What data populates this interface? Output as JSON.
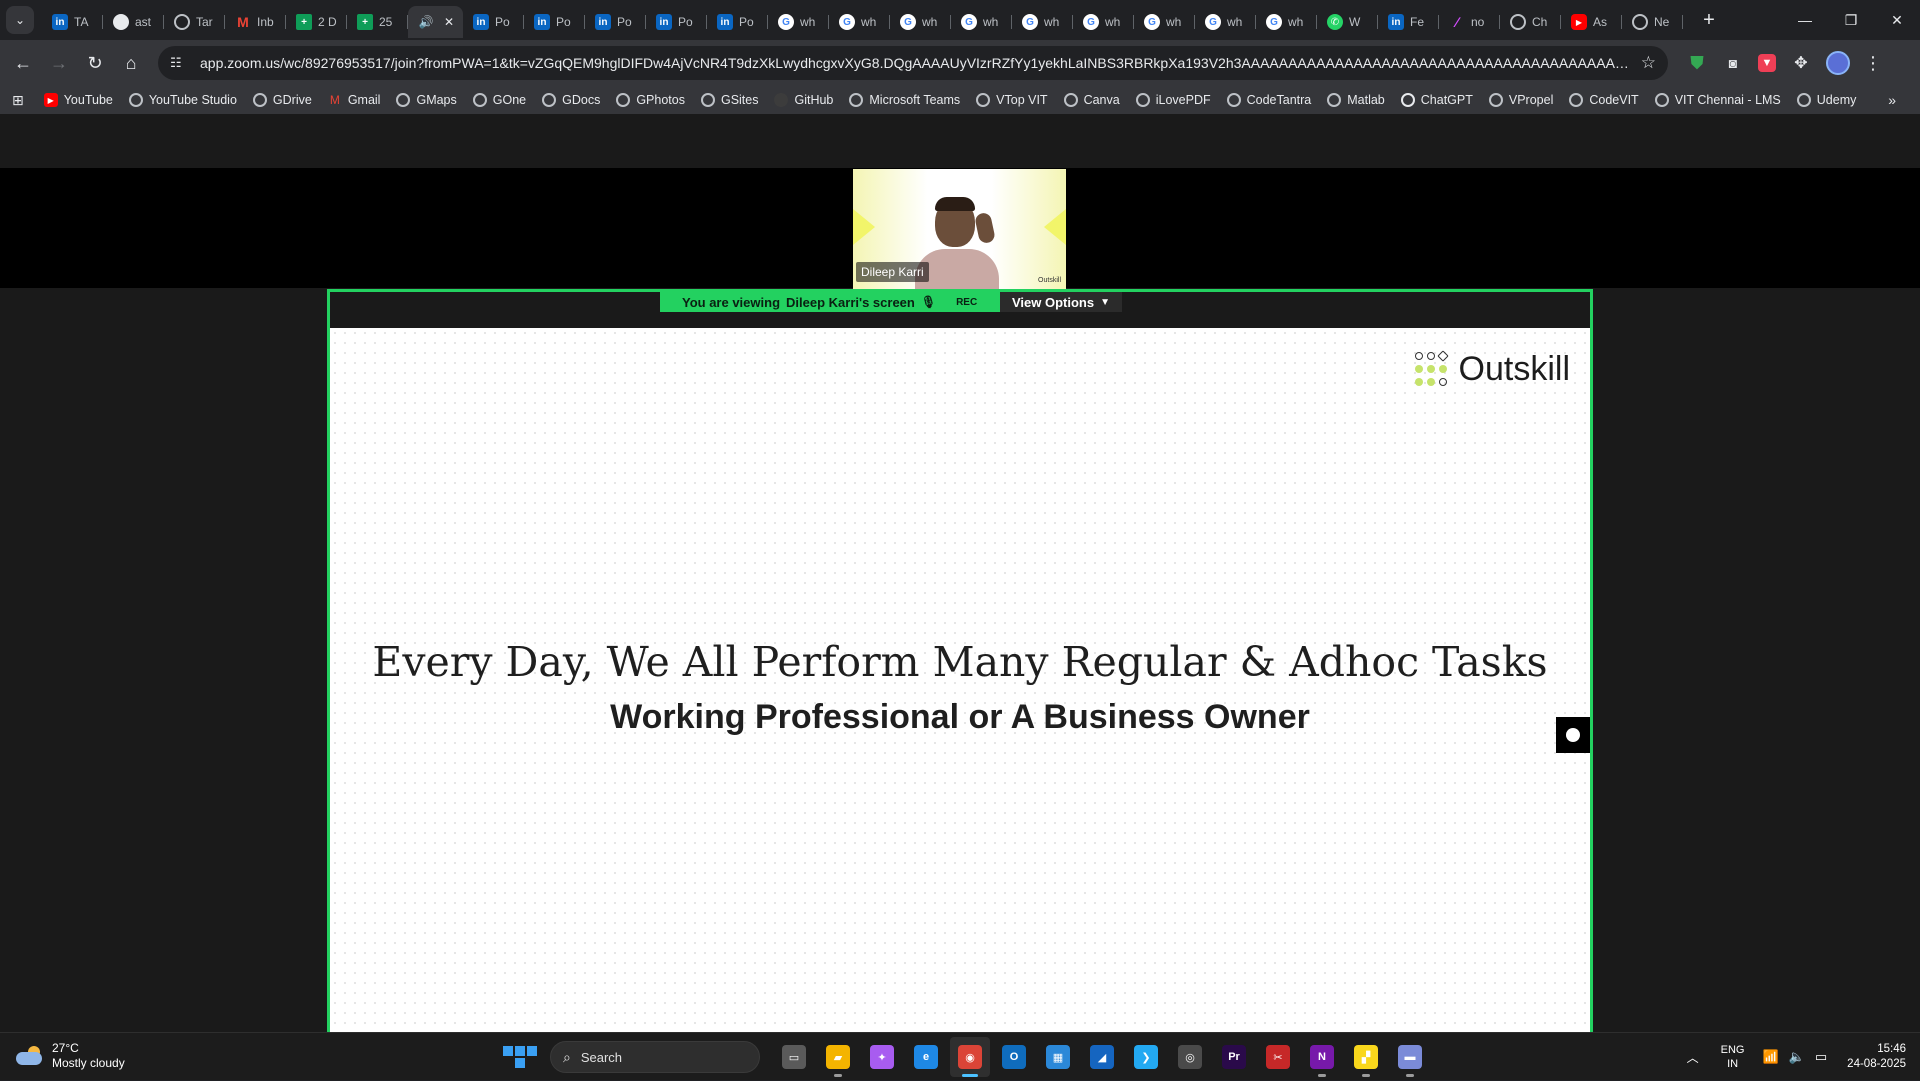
{
  "browser": {
    "tabs": [
      {
        "label": "TA",
        "icon": "linkedin-icon",
        "glyph": "in",
        "cls": "fav-linkedin"
      },
      {
        "label": "ast",
        "icon": "github-icon",
        "glyph": "",
        "cls": "fav-github"
      },
      {
        "label": "Tar",
        "icon": "globe-icon",
        "glyph": "",
        "cls": "fav-globe"
      },
      {
        "label": "Inb",
        "icon": "gmail-icon",
        "glyph": "M",
        "cls": "fav-gmail"
      },
      {
        "label": "2 D",
        "icon": "sheets-icon",
        "glyph": "+",
        "cls": "fav-sheets"
      },
      {
        "label": "25",
        "icon": "sheets-icon",
        "glyph": "+",
        "cls": "fav-sheets"
      },
      {
        "label": "",
        "icon": "speaker-icon",
        "glyph": "🔊",
        "cls": "fav-speaker",
        "active": true
      },
      {
        "label": "Po",
        "icon": "linkedin-icon",
        "glyph": "in",
        "cls": "fav-linkedin"
      },
      {
        "label": "Po",
        "icon": "linkedin-icon",
        "glyph": "in",
        "cls": "fav-linkedin"
      },
      {
        "label": "Po",
        "icon": "linkedin-icon",
        "glyph": "in",
        "cls": "fav-linkedin"
      },
      {
        "label": "Po",
        "icon": "linkedin-icon",
        "glyph": "in",
        "cls": "fav-linkedin"
      },
      {
        "label": "Po",
        "icon": "linkedin-icon",
        "glyph": "in",
        "cls": "fav-linkedin"
      },
      {
        "label": "wh",
        "icon": "google-icon",
        "glyph": "G",
        "cls": "fav-google"
      },
      {
        "label": "wh",
        "icon": "google-icon",
        "glyph": "G",
        "cls": "fav-google"
      },
      {
        "label": "wh",
        "icon": "google-icon",
        "glyph": "G",
        "cls": "fav-google"
      },
      {
        "label": "wh",
        "icon": "google-icon",
        "glyph": "G",
        "cls": "fav-google"
      },
      {
        "label": "wh",
        "icon": "google-icon",
        "glyph": "G",
        "cls": "fav-google"
      },
      {
        "label": "wh",
        "icon": "google-icon",
        "glyph": "G",
        "cls": "fav-google"
      },
      {
        "label": "wh",
        "icon": "google-icon",
        "glyph": "G",
        "cls": "fav-google"
      },
      {
        "label": "wh",
        "icon": "google-icon",
        "glyph": "G",
        "cls": "fav-google"
      },
      {
        "label": "wh",
        "icon": "google-icon",
        "glyph": "G",
        "cls": "fav-google"
      },
      {
        "label": "W",
        "icon": "whatsapp-icon",
        "glyph": "✆",
        "cls": "fav-whatsapp"
      },
      {
        "label": "Fe",
        "icon": "linkedin-icon",
        "glyph": "in",
        "cls": "fav-linkedin"
      },
      {
        "label": "no",
        "icon": "notion-icon",
        "glyph": "∕",
        "cls": "fav-notion"
      },
      {
        "label": "Ch",
        "icon": "chatgpt-icon",
        "glyph": "",
        "cls": "fav-chatgpt"
      },
      {
        "label": "As",
        "icon": "youtube-icon",
        "glyph": "▶",
        "cls": "fav-youtube"
      },
      {
        "label": "Ne",
        "icon": "globe-icon",
        "glyph": "",
        "cls": "fav-globe"
      }
    ],
    "url": "app.zoom.us/wc/89276953517/join?fromPWA=1&tk=vZGqQEM9hglDIFDw4AjVcNR4T9dzXkLwydhcgxvXyG8.DQgAAAAUyVIzrRZfYy1yekhLaINBS3RBRkpXa193V2h3AAAAAAAAAAAAAAAAAAAAAAAAAAAAAAAAAAAAAAAA&_x_zm_r...",
    "bookmarks": [
      {
        "label": "YouTube",
        "cls": "bm-yt",
        "glyph": "▶"
      },
      {
        "label": "YouTube Studio",
        "cls": "bm-globe",
        "glyph": ""
      },
      {
        "label": "GDrive",
        "cls": "bm-globe",
        "glyph": ""
      },
      {
        "label": "Gmail",
        "cls": "bm-gmail",
        "glyph": "M"
      },
      {
        "label": "GMaps",
        "cls": "bm-globe",
        "glyph": ""
      },
      {
        "label": "GOne",
        "cls": "bm-globe",
        "glyph": ""
      },
      {
        "label": "GDocs",
        "cls": "bm-globe",
        "glyph": ""
      },
      {
        "label": "GPhotos",
        "cls": "bm-globe",
        "glyph": ""
      },
      {
        "label": "GSites",
        "cls": "bm-globe",
        "glyph": ""
      },
      {
        "label": "GitHub",
        "cls": "bm-github",
        "glyph": ""
      },
      {
        "label": "Microsoft Teams",
        "cls": "bm-globe",
        "glyph": ""
      },
      {
        "label": "VTop VIT",
        "cls": "bm-globe",
        "glyph": ""
      },
      {
        "label": "Canva",
        "cls": "bm-globe",
        "glyph": ""
      },
      {
        "label": "iLovePDF",
        "cls": "bm-globe",
        "glyph": ""
      },
      {
        "label": "CodeTantra",
        "cls": "bm-globe",
        "glyph": ""
      },
      {
        "label": "Matlab",
        "cls": "bm-globe",
        "glyph": ""
      },
      {
        "label": "ChatGPT",
        "cls": "bm-chatgpt",
        "glyph": ""
      },
      {
        "label": "VPropel",
        "cls": "bm-globe",
        "glyph": ""
      },
      {
        "label": "CodeVIT",
        "cls": "bm-globe",
        "glyph": ""
      },
      {
        "label": "VIT Chennai - LMS",
        "cls": "bm-globe",
        "glyph": ""
      },
      {
        "label": "Udemy",
        "cls": "bm-globe",
        "glyph": ""
      }
    ],
    "more_bookmarks": "»"
  },
  "zoom": {
    "participant_name": "Dileep Karri",
    "tile_logo": "Outskill",
    "viewing_prefix": "You are viewing",
    "viewing_who": "Dileep Karri's screen",
    "rec_label": "REC",
    "view_options": "View Options"
  },
  "slide": {
    "brand": "Outskill",
    "title": "Every Day, We All Perform Many Regular & Adhoc Tasks",
    "subtitle": "Working Professional or A Business Owner"
  },
  "taskbar": {
    "temperature": "27°C",
    "weather": "Mostly cloudy",
    "search_label": "Search",
    "lang_top": "ENG",
    "lang_bottom": "IN",
    "time": "15:46",
    "date": "24-08-2025",
    "apps": [
      {
        "name": "task-view-icon",
        "glyph": "▭",
        "color": "#5a5a5a"
      },
      {
        "name": "file-explorer-icon",
        "glyph": "▰",
        "color": "#f4b400",
        "running": true
      },
      {
        "name": "copilot-icon",
        "glyph": "✦",
        "color": "#a85cf0"
      },
      {
        "name": "edge-icon",
        "glyph": "e",
        "color": "#1e88e5"
      },
      {
        "name": "chrome-icon",
        "glyph": "◉",
        "color": "#db4437",
        "active": true
      },
      {
        "name": "outlook-icon",
        "glyph": "O",
        "color": "#0f6cbd"
      },
      {
        "name": "store-icon",
        "glyph": "▦",
        "color": "#2b88d8"
      },
      {
        "name": "microsoft-todo-icon",
        "glyph": "◢",
        "color": "#1565c0"
      },
      {
        "name": "vscode-icon",
        "glyph": "❯",
        "color": "#23a9f2"
      },
      {
        "name": "obs-icon",
        "glyph": "◎",
        "color": "#4a4a4a"
      },
      {
        "name": "premiere-icon",
        "glyph": "Pr",
        "color": "#2a0a4a"
      },
      {
        "name": "snipping-tool-icon",
        "glyph": "✂",
        "color": "#c62828"
      },
      {
        "name": "onenote-icon",
        "glyph": "N",
        "color": "#7719aa",
        "running": true
      },
      {
        "name": "sticky-notes-icon",
        "glyph": "▞",
        "color": "#f9d71c",
        "running": true
      },
      {
        "name": "window-app-icon",
        "glyph": "▬",
        "color": "#7b8bd8",
        "running": true
      }
    ]
  }
}
